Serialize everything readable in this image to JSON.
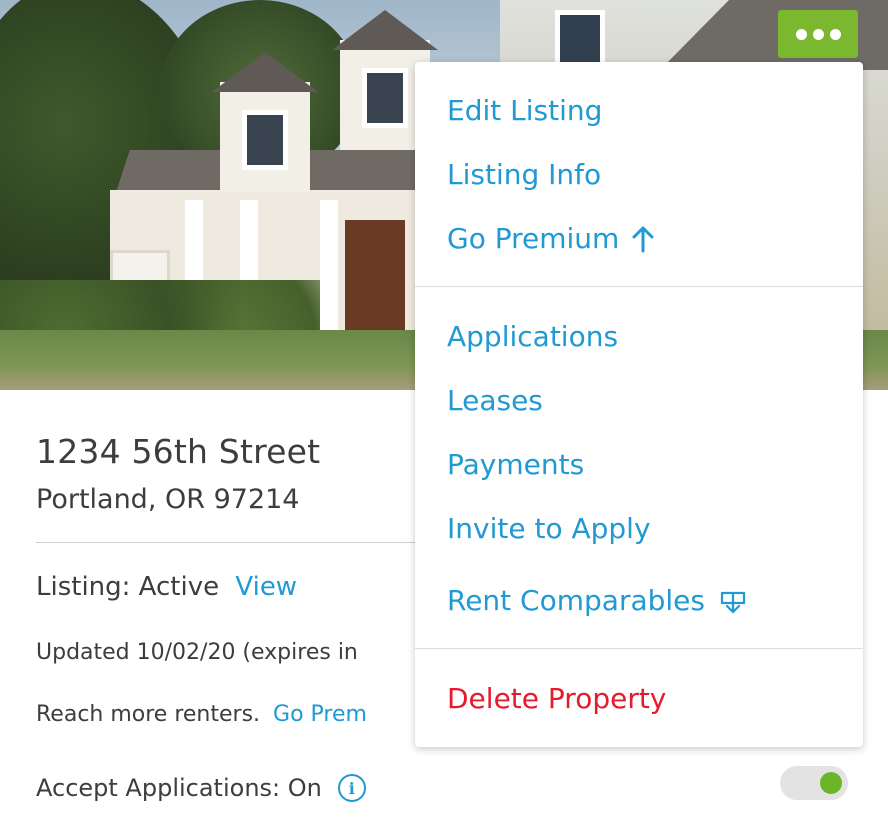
{
  "property": {
    "street": "1234 56th Street",
    "city_line": "Portland, OR 97214"
  },
  "listing": {
    "status_label": "Listing: Active",
    "view_link": "View",
    "updated_text": "Updated 10/02/20 (expires in",
    "reach_text": "Reach more renters.",
    "premium_link": "Go Prem"
  },
  "applications": {
    "accept_label": "Accept Applications: On",
    "info_glyph": "i",
    "toggle_on": true
  },
  "more_button": {
    "icon": "ellipsis-icon",
    "color": "#7cb82f"
  },
  "menu": {
    "group1": [
      "Edit Listing",
      "Listing Info",
      "Go Premium"
    ],
    "group2": [
      "Applications",
      "Leases",
      "Payments",
      "Invite to Apply",
      "Rent Comparables"
    ],
    "group3": [
      "Delete Property"
    ],
    "link_color": "#2199d3",
    "danger_color": "#e51a2c"
  }
}
